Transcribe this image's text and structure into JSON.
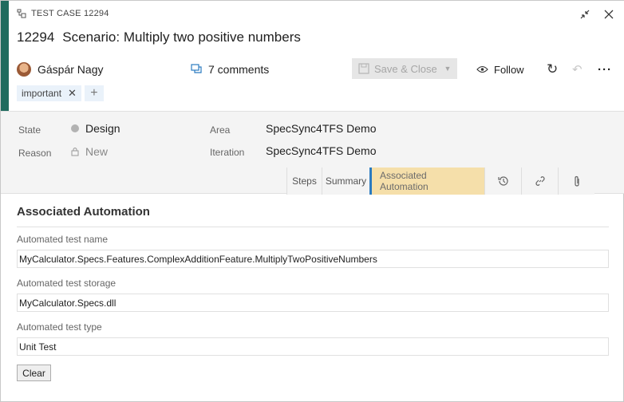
{
  "work_item": {
    "type_label": "TEST CASE 12294",
    "id": "12294",
    "title": "Scenario: Multiply two positive numbers"
  },
  "header": {
    "assignee": "Gáspár Nagy",
    "comments": "7 comments",
    "save_close_label": "Save & Close",
    "follow_label": "Follow",
    "tags": [
      "important"
    ]
  },
  "details": {
    "state_label": "State",
    "state_value": "Design",
    "reason_label": "Reason",
    "reason_value": "New",
    "area_label": "Area",
    "area_value": "SpecSync4TFS Demo",
    "iteration_label": "Iteration",
    "iteration_value": "SpecSync4TFS Demo"
  },
  "tabs": [
    {
      "label": "Steps"
    },
    {
      "label": "Summary"
    },
    {
      "label": "Associated Automation"
    }
  ],
  "automation": {
    "section_title": "Associated Automation",
    "test_name_label": "Automated test name",
    "test_name_value": "MyCalculator.Specs.Features.ComplexAdditionFeature.MultiplyTwoPositiveNumbers",
    "test_storage_label": "Automated test storage",
    "test_storage_value": "MyCalculator.Specs.dll",
    "test_type_label": "Automated test type",
    "test_type_value": "Unit Test",
    "clear_label": "Clear"
  },
  "colors": {
    "accent": "#1f6b5e",
    "active_tab_highlight": "#f5dfaa",
    "active_tab_border": "#2b7bc0"
  }
}
